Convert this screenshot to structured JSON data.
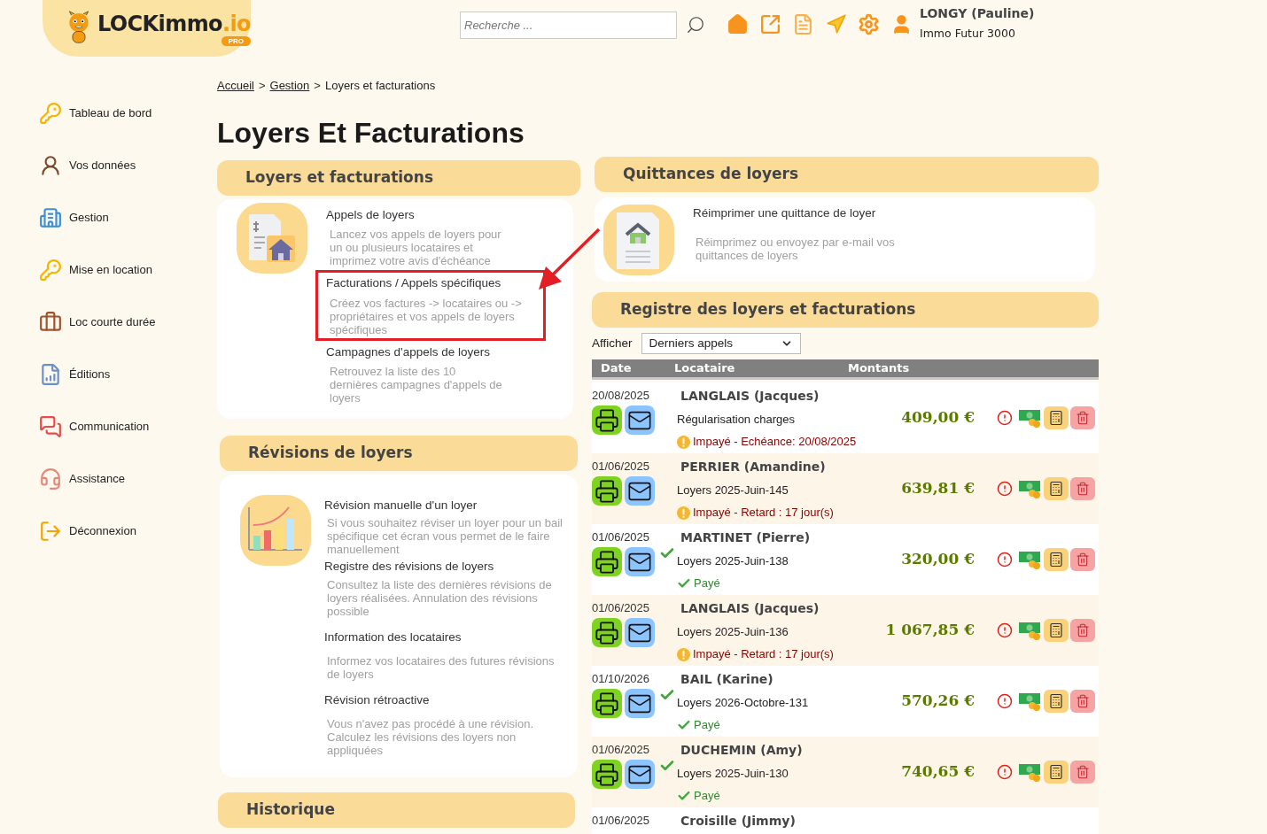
{
  "header": {
    "logo": {
      "name": "LOCKimmo",
      "suffix": ".io",
      "badge": "PRO"
    },
    "search": {
      "placeholder": "Recherche ..."
    },
    "user": {
      "name": "LONGY (Pauline)",
      "company": "Immo Futur 3000"
    }
  },
  "sidebar": {
    "items": [
      {
        "label": "Tableau de bord"
      },
      {
        "label": "Vos données"
      },
      {
        "label": "Gestion"
      },
      {
        "label": "Mise en location"
      },
      {
        "label": "Loc courte durée"
      },
      {
        "label": "Éditions"
      },
      {
        "label": "Communication"
      },
      {
        "label": "Assistance"
      },
      {
        "label": "Déconnexion"
      }
    ]
  },
  "breadcrumb": {
    "separator": ">",
    "items": [
      {
        "label": "Accueil",
        "link": true
      },
      {
        "label": "Gestion",
        "link": true
      },
      {
        "label": "Loyers et facturations",
        "link": false
      }
    ]
  },
  "title": "Loyers Et Facturations",
  "rent_section": {
    "title": "Loyers et facturations",
    "items": [
      {
        "title": "Appels de loyers",
        "description": "Lancez vos appels de loyers pour un ou plusieurs locataires et imprimez votre avis d'échéance",
        "highlighted": false
      },
      {
        "title": "Facturations / Appels spécifiques",
        "description": "Créez vos factures -> locataires ou -> propriétaires et vos appels de loyers spécifiques",
        "highlighted": true
      },
      {
        "title": "Campagnes d'appels de loyers",
        "description": "Retrouvez la liste des 10 dernières campagnes d'appels de loyers",
        "highlighted": false
      }
    ]
  },
  "revision_section": {
    "title": "Révisions de loyers",
    "items": [
      {
        "title": "Révision manuelle d'un loyer",
        "description": "Si vous souhaitez réviser un loyer pour un bail spécifique cet écran vous permet de le faire manuellement"
      },
      {
        "title": "Registre des révisions de loyers",
        "description": "Consultez la liste des dernières révisions de loyers réalisées. Annulation des révisions possible"
      },
      {
        "title": "Information des locataires",
        "description": "Informez vos locataires des futures révisions de loyers"
      },
      {
        "title": "Révision rétroactive",
        "description": "Vous n'avez pas procédé à une révision. Calculez les révisions des loyers non appliquées"
      }
    ]
  },
  "history_section": {
    "title": "Historique"
  },
  "receipts_section": {
    "title": "Quittances de loyers",
    "items": [
      {
        "title": "Réimprimer une quittance de loyer",
        "description": "Réimprimez ou envoyez par e-mail vos quittances de loyers"
      }
    ]
  },
  "register": {
    "title": "Registre des loyers et facturations",
    "filter": {
      "label": "Afficher",
      "value": "Derniers appels"
    },
    "columns": [
      "Date",
      "Locataire",
      "Montants"
    ],
    "rows": [
      {
        "date": "20/08/2025",
        "tenant": "LANGLAIS (Jacques)",
        "label": "Régularisation charges",
        "status": {
          "kind": "unpaid",
          "text": "Impayé - Echéance: 20/08/2025"
        },
        "amount": "409,00 €",
        "sent": false
      },
      {
        "date": "01/06/2025",
        "tenant": "PERRIER (Amandine)",
        "label": "Loyers 2025-Juin-145",
        "status": {
          "kind": "unpaid",
          "text": "Impayé - Retard : 17 jour(s)"
        },
        "amount": "639,81 €",
        "sent": false
      },
      {
        "date": "01/06/2025",
        "tenant": "MARTINET (Pierre)",
        "label": "Loyers 2025-Juin-138",
        "status": {
          "kind": "paid",
          "text": "Payé"
        },
        "amount": "320,00 €",
        "sent": true
      },
      {
        "date": "01/06/2025",
        "tenant": "LANGLAIS (Jacques)",
        "label": "Loyers 2025-Juin-136",
        "status": {
          "kind": "unpaid",
          "text": "Impayé - Retard : 17 jour(s)"
        },
        "amount": "1 067,85 €",
        "sent": false
      },
      {
        "date": "01/10/2026",
        "tenant": "BAIL (Karine)",
        "label": "Loyers 2026-Octobre-131",
        "status": {
          "kind": "paid",
          "text": "Payé"
        },
        "amount": "570,26 €",
        "sent": true
      },
      {
        "date": "01/06/2025",
        "tenant": "DUCHEMIN (Amy)",
        "label": "Loyers 2025-Juin-130",
        "status": {
          "kind": "paid",
          "text": "Payé"
        },
        "amount": "740,65 €",
        "sent": true
      },
      {
        "date": "01/06/2025",
        "tenant": "Croisille (Jimmy)"
      }
    ]
  }
}
